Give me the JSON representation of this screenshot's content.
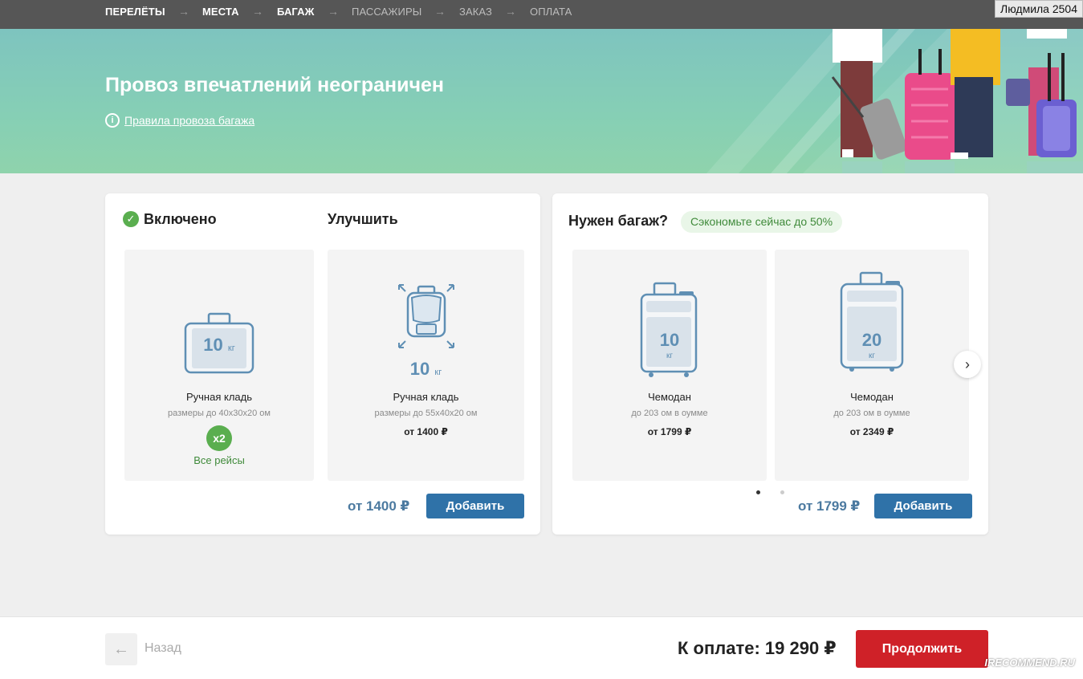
{
  "steps": [
    {
      "label": "ПЕРЕЛЁТЫ",
      "done": true
    },
    {
      "label": "МЕСТА",
      "done": true
    },
    {
      "label": "БАГАЖ",
      "done": true
    },
    {
      "label": "ПАССАЖИРЫ",
      "done": false
    },
    {
      "label": "ЗАКАЗ",
      "done": false
    },
    {
      "label": "ОПЛАТА",
      "done": false
    }
  ],
  "watermark_user": "Людмила 2504",
  "hero": {
    "title": "Провоз впечатлений неограничен",
    "link": "Правила провоза багажа"
  },
  "left_card": {
    "included_label": "Включено",
    "upgrade_label": "Улучшить",
    "included_tile": {
      "weight": "10",
      "unit": "кг",
      "name": "Ручная кладь",
      "size": "размеры до 40х30х20 ом",
      "multiplier": "x2",
      "all_flights": "Все рейсы"
    },
    "upgrade_tile": {
      "weight": "10",
      "unit": "кг",
      "name": "Ручная кладь",
      "size": "размеры до 55х40х20 ом",
      "price": "от  1400 ₽"
    },
    "price": "от  1400 ₽",
    "add_button": "Добавить"
  },
  "right_card": {
    "title": "Нужен багаж?",
    "promo": "Сэкономьте сейчас до 50%",
    "tiles": [
      {
        "weight": "10",
        "unit": "кг",
        "name": "Чемодан",
        "size": "до 203 ом в оумме",
        "price": "от  1799 ₽"
      },
      {
        "weight": "20",
        "unit": "кг",
        "name": "Чемодан",
        "size": "до 203 ом в оумме",
        "price": "от  2349 ₽"
      }
    ],
    "price": "от  1799 ₽",
    "add_button": "Добавить",
    "carousel_page": 1,
    "carousel_pages": 2
  },
  "footer": {
    "back_label": "Назад",
    "total": "К оплате:  19 290 ₽",
    "continue_button": "Продолжить",
    "watermark": "IRECOMMEND.RU"
  },
  "colors": {
    "accent_blue": "#2f72a8",
    "price_blue": "#4c7aa0",
    "green": "#5aae4f",
    "red": "#cf2128"
  }
}
